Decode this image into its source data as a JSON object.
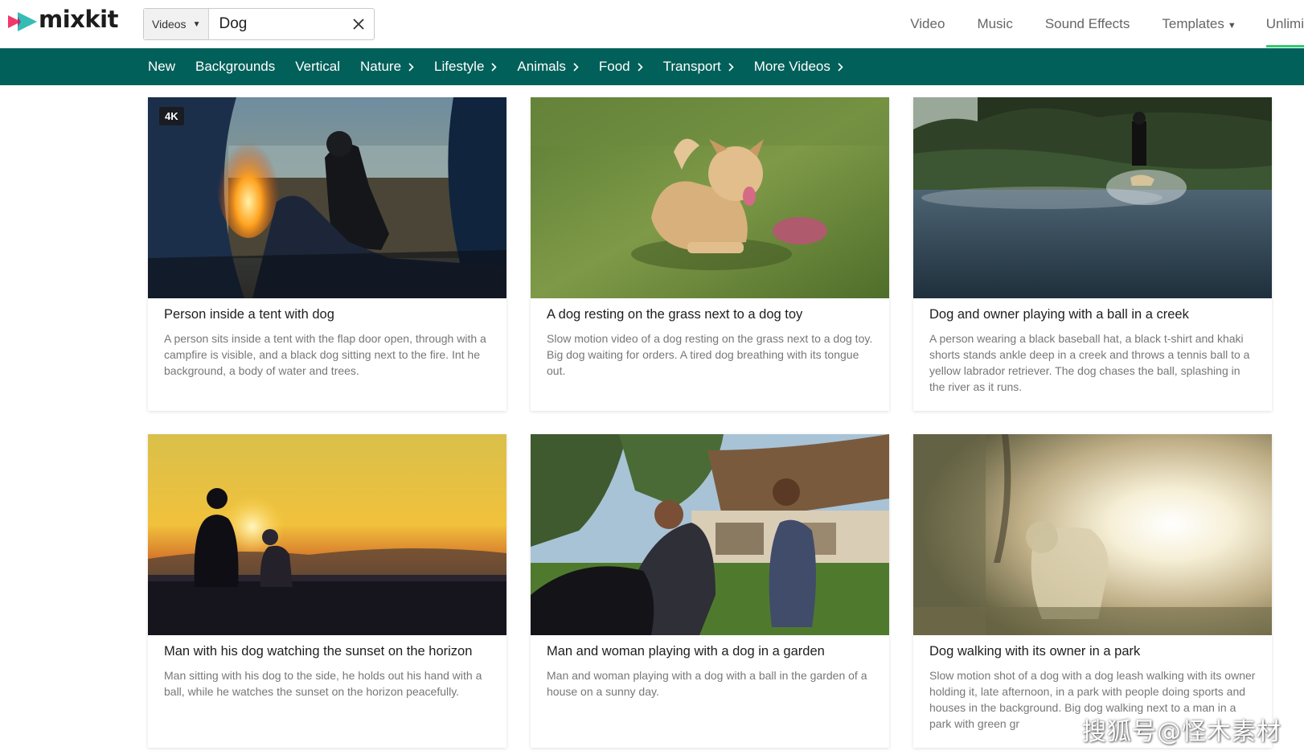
{
  "header": {
    "logo_text": "mixkit",
    "search": {
      "type_label": "Videos",
      "value": "Dog",
      "placeholder": ""
    },
    "nav": [
      {
        "label": "Video"
      },
      {
        "label": "Music"
      },
      {
        "label": "Sound Effects"
      },
      {
        "label": "Templates"
      },
      {
        "label": "Unlimi"
      }
    ]
  },
  "categories": [
    {
      "label": "New",
      "has_submenu": false
    },
    {
      "label": "Backgrounds",
      "has_submenu": false
    },
    {
      "label": "Vertical",
      "has_submenu": false
    },
    {
      "label": "Nature",
      "has_submenu": true
    },
    {
      "label": "Lifestyle",
      "has_submenu": true
    },
    {
      "label": "Animals",
      "has_submenu": true
    },
    {
      "label": "Food",
      "has_submenu": true
    },
    {
      "label": "Transport",
      "has_submenu": true
    },
    {
      "label": "More Videos",
      "has_submenu": true
    }
  ],
  "cards": [
    {
      "badge": "4K",
      "title": "Person inside a tent with dog",
      "description": "A person sits inside a tent with the flap door open, through with a campfire is visible, and a black dog sitting next to the fire. Int he background, a body of water and trees."
    },
    {
      "badge": "",
      "title": "A dog resting on the grass next to a dog toy",
      "description": "Slow motion video of a dog resting on the grass next to a dog toy. Big dog waiting for orders. A tired dog breathing with its tongue out."
    },
    {
      "badge": "",
      "title": "Dog and owner playing with a ball in a creek",
      "description": "A person wearing a black baseball hat, a black t-shirt and khaki shorts stands ankle deep in a creek and throws a tennis ball to a yellow labrador retriever. The dog chases the ball, splashing in the river as it runs."
    },
    {
      "badge": "",
      "title": "Man with his dog watching the sunset on the horizon",
      "description": "Man sitting with his dog to the side, he holds out his hand with a ball, while he watches the sunset on the horizon peacefully."
    },
    {
      "badge": "",
      "title": "Man and woman playing with a dog in a garden",
      "description": "Man and woman playing with a dog with a ball in the garden of a house on a sunny day."
    },
    {
      "badge": "",
      "title": "Dog walking with its owner in a park",
      "description": "Slow motion shot of a dog with a dog leash walking with its owner holding it, late afternoon, in a park with people doing sports and houses in the background. Big dog walking next to a man in a park with green gr"
    }
  ],
  "watermark": "搜狐号@怪木素材",
  "colors": {
    "category_bar": "#02605a",
    "nav_active_underline": "#2ecc71",
    "logo_pink": "#f0386b",
    "logo_teal": "#1fb6ad"
  },
  "icons": {
    "logo": "mixkit-logo-icon",
    "search_type_caret": "caret-down-icon",
    "clear": "close-icon",
    "submenu": "chevron-right-icon"
  }
}
